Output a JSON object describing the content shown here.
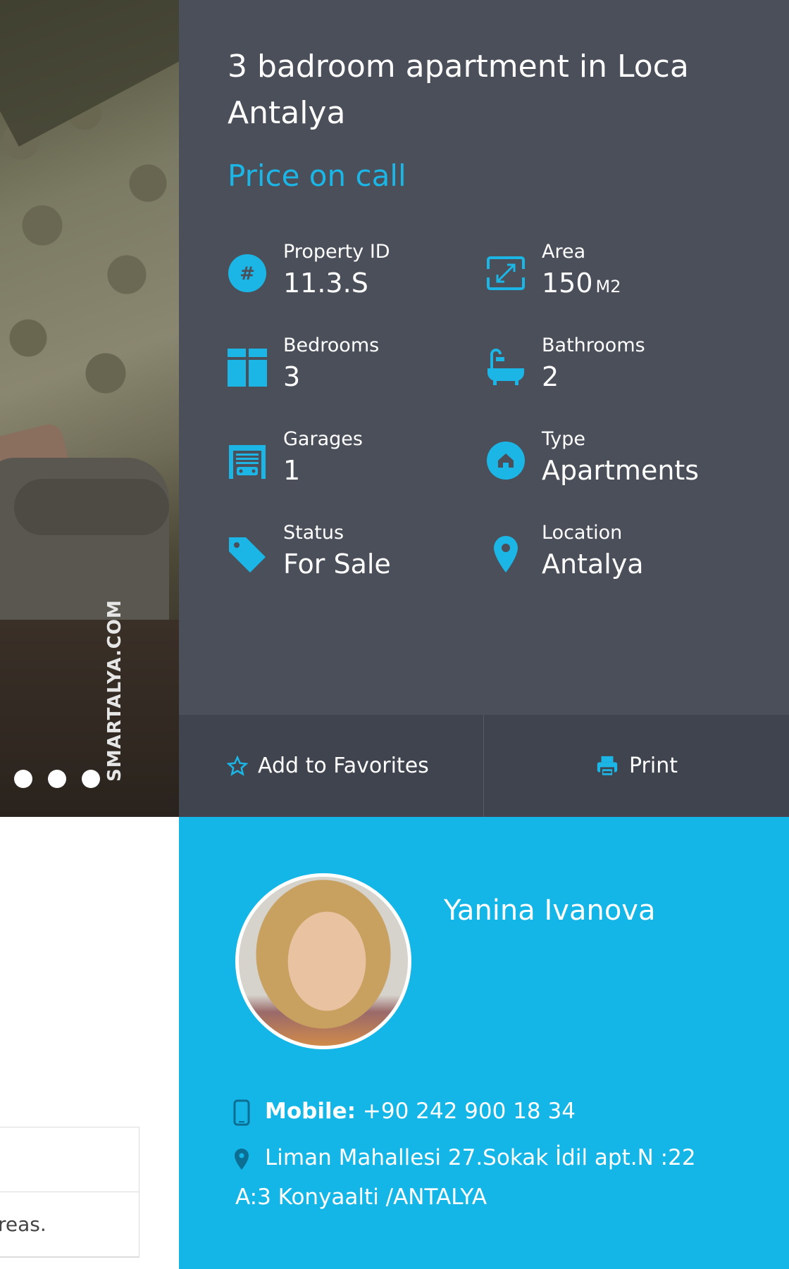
{
  "gallery": {
    "watermark": "SMARTALYA.COM",
    "slide_count": 3
  },
  "property": {
    "title": "3 badroom apartment in Loca Antalya",
    "price": "Price on call",
    "features": [
      {
        "label": "Property ID",
        "value": "11.3.S",
        "icon": "hash-icon"
      },
      {
        "label": "Area",
        "value": "150",
        "unit": "M2",
        "icon": "area-icon"
      },
      {
        "label": "Bedrooms",
        "value": "3",
        "icon": "bedroom-icon"
      },
      {
        "label": "Bathrooms",
        "value": "2",
        "icon": "bathtub-icon"
      },
      {
        "label": "Garages",
        "value": "1",
        "icon": "garage-icon"
      },
      {
        "label": "Type",
        "value": "Apartments",
        "icon": "home-icon"
      },
      {
        "label": "Status",
        "value": "For Sale",
        "icon": "tag-icon"
      },
      {
        "label": "Location",
        "value": "Antalya",
        "icon": "map-pin-icon"
      }
    ]
  },
  "actions": {
    "favorites": "Add to Favorites",
    "print": "Print"
  },
  "agent": {
    "name": "Yanina Ivanova",
    "mobile_label": "Mobile:",
    "mobile": "+90 242 900 18 34",
    "address_line1": "Liman Mahallesi 27.Sokak İdil apt.N :22",
    "address_line2": "A:3 Konyaalti /ANTALYA"
  },
  "table": {
    "rows": [
      "",
      "reas."
    ]
  },
  "colors": {
    "accent": "#1bb6e6",
    "panel_dark": "#4a4f59",
    "actions_bar": "#3f444e",
    "agent_bg": "#13b6e6"
  }
}
